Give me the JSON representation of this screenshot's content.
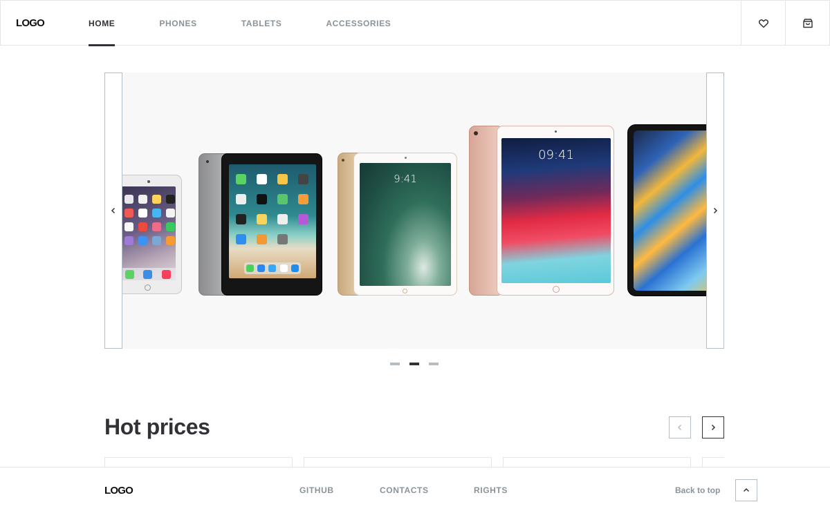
{
  "header": {
    "logo": "LOGO",
    "nav": [
      {
        "label": "HOME",
        "active": true
      },
      {
        "label": "PHONES",
        "active": false
      },
      {
        "label": "TABLETS",
        "active": false
      },
      {
        "label": "ACCESSORIES",
        "active": false
      }
    ],
    "favourites_icon": "heart-icon",
    "cart_icon": "shopping-bag-icon"
  },
  "banner": {
    "prev_icon": "chevron-left-icon",
    "next_icon": "chevron-right-icon",
    "tablets": [
      {
        "model": "ipad-mini",
        "color": "silver"
      },
      {
        "model": "ipad",
        "color": "space-gray"
      },
      {
        "model": "ipad-pro-10.5",
        "color": "gold",
        "time": "9:41"
      },
      {
        "model": "ipad-pro-10.5",
        "color": "rose-gold",
        "time": "09:41"
      },
      {
        "model": "ipad-pro-11",
        "color": "black"
      }
    ],
    "dots": [
      false,
      true,
      false
    ]
  },
  "hot_prices": {
    "title": "Hot prices",
    "prev_icon": "chevron-left-icon",
    "next_icon": "chevron-right-icon"
  },
  "footer": {
    "logo": "LOGO",
    "links": [
      "GITHUB",
      "CONTACTS",
      "RIGHTS"
    ],
    "back_to_top": "Back to top",
    "back_icon": "chevron-up-icon"
  },
  "colors": {
    "primary": "#313237",
    "secondary": "#89939a",
    "border": "#e2e6e9",
    "icons": "#b4bdc3"
  }
}
